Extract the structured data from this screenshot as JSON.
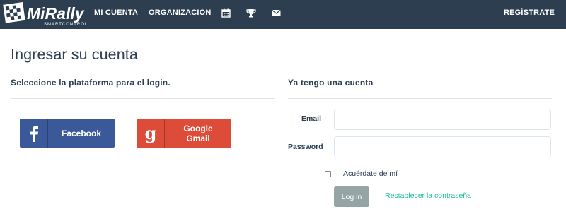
{
  "navbar": {
    "brand": "MiRally",
    "brand_tagline": "SMARTCONTROL",
    "items": [
      {
        "label": "MI CUENTA"
      },
      {
        "label": "ORGANIZACIÓN"
      }
    ],
    "icons": [
      "calendar-icon",
      "trophy-icon",
      "envelope-icon"
    ],
    "register_label": "REGÍSTRATE"
  },
  "page": {
    "title": "Ingresar su cuenta"
  },
  "social_login": {
    "heading": "Seleccione la plataforma para el login.",
    "facebook_label": "Facebook",
    "google_label": "Google\nGmail"
  },
  "account_login": {
    "heading": "Ya tengo una cuenta",
    "email_label": "Email",
    "email_value": "",
    "password_label": "Password",
    "password_value": "",
    "remember_label": "Acuérdate de mí",
    "remember_checked": false,
    "login_label": "Log in",
    "reset_label": "Restablecer la contraseña"
  },
  "colors": {
    "navbar": "#2c3e50",
    "facebook": "#3b5998",
    "google": "#dd4b39",
    "login_button": "#95a5a6",
    "link": "#18bc9c"
  }
}
